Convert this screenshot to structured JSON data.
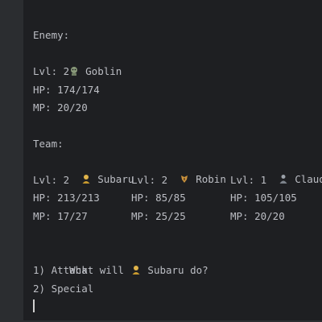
{
  "enemy": {
    "header": "Enemy:",
    "name": "Goblin",
    "icon": "goblin-icon",
    "lvl": "Lvl: 2",
    "hp": "HP: 174/174",
    "mp": "MP: 20/20"
  },
  "team": {
    "header": "Team:",
    "members": [
      {
        "name": "Subaru",
        "icon": "hero-icon",
        "lvl": "Lvl: 2",
        "hp": "HP: 213/213",
        "mp": "MP: 17/27"
      },
      {
        "name": "Robin",
        "icon": "archer-icon",
        "lvl": "Lvl: 2",
        "hp": "HP: 85/85",
        "mp": "MP: 25/25"
      },
      {
        "name": "Claude",
        "icon": "mage-icon",
        "lvl": "Lvl: 1",
        "hp": "HP: 105/105",
        "mp": "MP: 20/20"
      }
    ]
  },
  "prompt": {
    "prefix": "What will",
    "name": "Subaru",
    "suffix": "do?",
    "options": [
      "1) Attack",
      "2) Special"
    ]
  },
  "colors": {
    "background": "#1e1f22",
    "text": "#bcbec4",
    "panel": "#2b2d30"
  }
}
